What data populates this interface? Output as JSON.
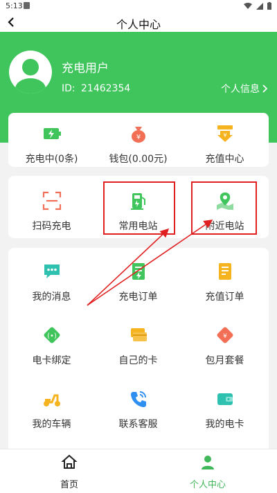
{
  "status_bar": {
    "time": "5:13"
  },
  "header": {
    "title": "个人中心",
    "back_icon": "back-arrow-icon"
  },
  "user": {
    "name": "充电用户",
    "id_label": "ID:",
    "id_value": "21462354",
    "profile_link": "个人信息",
    "avatar_icon": "user-avatar-icon"
  },
  "summary": [
    {
      "label": "充电中(0条)",
      "icon": "battery-charging-icon"
    },
    {
      "label": "钱包(0.00元)",
      "icon": "money-bag-icon"
    },
    {
      "label": "充值中心",
      "icon": "recharge-arrow-icon"
    }
  ],
  "quick_actions": [
    {
      "label": "扫码充电",
      "icon": "scan-icon"
    },
    {
      "label": "常用电站",
      "icon": "charging-station-icon"
    },
    {
      "label": "附近电站",
      "icon": "map-pin-icon"
    }
  ],
  "services": [
    {
      "label": "我的消息",
      "icon": "message-icon"
    },
    {
      "label": "充电订单",
      "icon": "charge-order-icon"
    },
    {
      "label": "充值订单",
      "icon": "recharge-order-icon"
    },
    {
      "label": "电卡绑定",
      "icon": "card-bind-icon"
    },
    {
      "label": "自己的卡",
      "icon": "cards-icon"
    },
    {
      "label": "包月套餐",
      "icon": "monthly-package-icon"
    },
    {
      "label": "我的车辆",
      "icon": "scooter-icon"
    },
    {
      "label": "联系客服",
      "icon": "phone-icon"
    },
    {
      "label": "我的电卡",
      "icon": "wallet-icon"
    }
  ],
  "tab_bar": [
    {
      "label": "首页",
      "icon": "home-icon",
      "active": false
    },
    {
      "label": "个人中心",
      "icon": "person-icon",
      "active": true
    }
  ],
  "colors": {
    "brand_green": "#3fc55c",
    "annotation_red": "#e02020",
    "orange": "#f5a623",
    "tab_active": "#3fb85a"
  }
}
